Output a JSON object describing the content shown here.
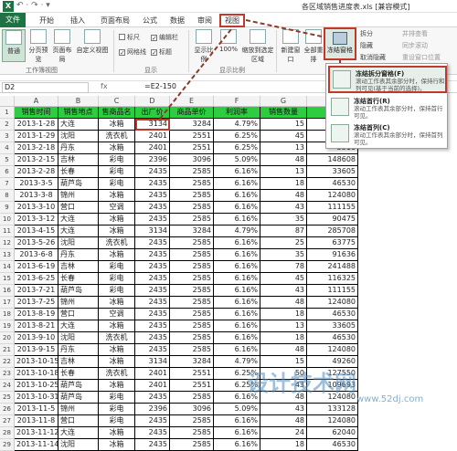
{
  "window": {
    "title": "各区域销售进度表.xls [兼容模式]",
    "app_icon": "X",
    "quick_access": "↶ · ↷ · ▾"
  },
  "tabs": [
    {
      "label": "文件"
    },
    {
      "label": "开始"
    },
    {
      "label": "插入"
    },
    {
      "label": "页面布局"
    },
    {
      "label": "公式"
    },
    {
      "label": "数据"
    },
    {
      "label": "审阅"
    },
    {
      "label": "视图"
    }
  ],
  "ribbon": {
    "normal": "普通",
    "page_break": "分页预览",
    "page_layout": "页面布局",
    "custom_view": "自定义视图",
    "group_views": "工作簿视图",
    "ruler": "标尺",
    "gridlines": "网格线",
    "formula_bar": "编辑栏",
    "headings": "标题",
    "group_show": "显示",
    "zoom": "显示比例",
    "zoom100": "100%",
    "zoom_selection": "缩放到选定区域",
    "group_zoom": "显示比例",
    "new_window": "新建窗口",
    "arrange_all": "全部重排",
    "freeze_panes": "冻结窗格",
    "split": "拆分",
    "hide": "隐藏",
    "unhide": "取消隐藏",
    "side_by_side": "并排查看",
    "sync_scroll": "同步滚动",
    "reset_pos": "重设窗口位置"
  },
  "formula": {
    "namebox": "D2",
    "fx": "fx",
    "value": "=E2-150"
  },
  "dropdown": [
    {
      "title": "冻结拆分窗格(F)",
      "desc": "滚动工作表其余部分时，保持行和列可见(基于当前的选择)。"
    },
    {
      "title": "冻结首行(R)",
      "desc": "滚动工作表其余部分时，保持首行可见。"
    },
    {
      "title": "冻结首列(C)",
      "desc": "滚动工作表其余部分时，保持首列可见。"
    }
  ],
  "columns": [
    "A",
    "B",
    "C",
    "D",
    "E",
    "F",
    "G",
    "H"
  ],
  "header_row": [
    "销售时间",
    "销售地点",
    "售商品名",
    "出厂价",
    "商品单价",
    "利润率",
    "销售数量",
    "销售"
  ],
  "rows": [
    [
      "2013-1-28",
      "大连",
      "冰箱",
      "3134",
      "3284",
      "4.79%",
      "15",
      "4926"
    ],
    [
      "2013-1-29",
      "沈阳",
      "洗衣机",
      "2401",
      "2551",
      "6.25%",
      "45",
      "11479"
    ],
    [
      "2013-2-18",
      "丹东",
      "冰箱",
      "2401",
      "2551",
      "6.25%",
      "13",
      "3316"
    ],
    [
      "2013-2-15",
      "吉林",
      "彩电",
      "2396",
      "3096",
      "5.09%",
      "48",
      "148608"
    ],
    [
      "2013-2-28",
      "长春",
      "彩电",
      "2435",
      "2585",
      "6.16%",
      "13",
      "33605"
    ],
    [
      "2013-3-5",
      "葫芦岛",
      "彩电",
      "2435",
      "2585",
      "6.16%",
      "18",
      "46530"
    ],
    [
      "2013-3-8",
      "锦州",
      "冰箱",
      "2435",
      "2585",
      "6.16%",
      "48",
      "124080"
    ],
    [
      "2013-3-10",
      "营口",
      "空调",
      "2435",
      "2585",
      "6.16%",
      "43",
      "111155"
    ],
    [
      "2013-3-12",
      "大连",
      "冰箱",
      "2435",
      "2585",
      "6.16%",
      "35",
      "90475"
    ],
    [
      "2013-4-15",
      "大连",
      "冰箱",
      "3134",
      "3284",
      "4.79%",
      "87",
      "285708"
    ],
    [
      "2013-5-26",
      "沈阳",
      "洗衣机",
      "2435",
      "2585",
      "6.16%",
      "25",
      "63775"
    ],
    [
      "2013-6-8",
      "丹东",
      "冰箱",
      "2435",
      "2585",
      "6.16%",
      "35",
      "91636"
    ],
    [
      "2013-6-19",
      "吉林",
      "彩电",
      "2435",
      "2585",
      "6.16%",
      "78",
      "241488"
    ],
    [
      "2013-6-25",
      "长春",
      "彩电",
      "2435",
      "2585",
      "6.16%",
      "45",
      "116325"
    ],
    [
      "2013-7-21",
      "葫芦岛",
      "彩电",
      "2435",
      "2585",
      "6.16%",
      "43",
      "111155"
    ],
    [
      "2013-7-25",
      "锦州",
      "冰箱",
      "2435",
      "2585",
      "6.16%",
      "48",
      "124080"
    ],
    [
      "2013-8-19",
      "营口",
      "空调",
      "2435",
      "2585",
      "6.16%",
      "18",
      "46530"
    ],
    [
      "2013-8-21",
      "大连",
      "冰箱",
      "2435",
      "2585",
      "6.16%",
      "13",
      "33605"
    ],
    [
      "2013-9-10",
      "沈阳",
      "洗衣机",
      "2435",
      "2585",
      "6.16%",
      "18",
      "46530"
    ],
    [
      "2013-9-15",
      "丹东",
      "冰箱",
      "2435",
      "2585",
      "6.16%",
      "48",
      "124080"
    ],
    [
      "2013-10-15",
      "吉林",
      "冰箱",
      "3134",
      "3284",
      "4.79%",
      "15",
      "49260"
    ],
    [
      "2013-10-18",
      "长春",
      "洗衣机",
      "2401",
      "2551",
      "6.25%",
      "50",
      "127550"
    ],
    [
      "2013-10-25",
      "葫芦岛",
      "冰箱",
      "2401",
      "2551",
      "6.25%",
      "43",
      "109693"
    ],
    [
      "2013-10-31",
      "葫芦岛",
      "彩电",
      "2435",
      "2585",
      "6.16%",
      "48",
      "124080"
    ],
    [
      "2013-11-5",
      "锦州",
      "彩电",
      "2396",
      "3096",
      "5.09%",
      "43",
      "133128"
    ],
    [
      "2013-11-8",
      "营口",
      "彩电",
      "2435",
      "2585",
      "6.16%",
      "48",
      "124080"
    ],
    [
      "2013-11-12",
      "大连",
      "冰箱",
      "2435",
      "2585",
      "6.16%",
      "24",
      "62040"
    ],
    [
      "2013-11-14",
      "沈阳",
      "冰箱",
      "2435",
      "2585",
      "6.16%",
      "18",
      "46530"
    ]
  ],
  "watermark": {
    "logo": "设计技术网",
    "url": "www.52dj.com"
  }
}
